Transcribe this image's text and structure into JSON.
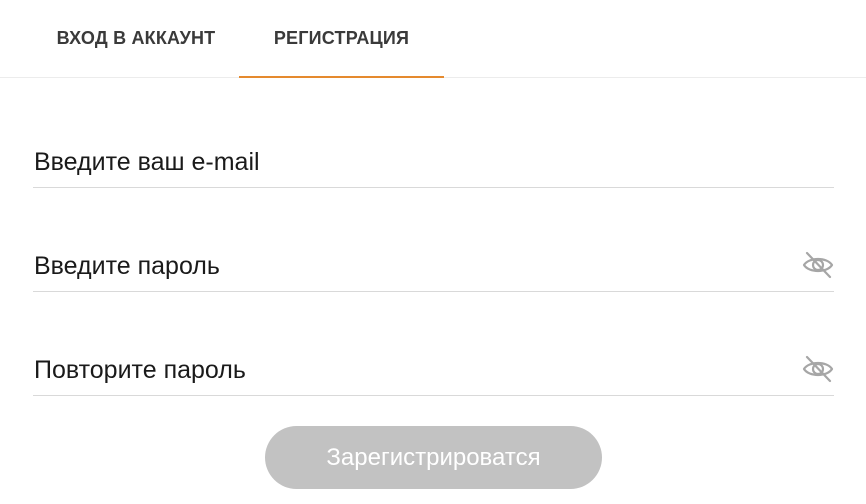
{
  "tabs": {
    "login": "ВХОД В АККАУНТ",
    "register": "РЕГИСТРАЦИЯ",
    "active": "register",
    "accent_color": "#e58a2e"
  },
  "form": {
    "email_placeholder": "Введите ваш e-mail",
    "email_value": "",
    "password_placeholder": "Введите пароль",
    "password_value": "",
    "repeat_password_placeholder": "Повторите пароль",
    "repeat_password_value": "",
    "toggle_visibility_icon": "eye-slash-icon",
    "submit_label": "Зарегистрироватся",
    "submit_color": "#c2c2c2"
  }
}
